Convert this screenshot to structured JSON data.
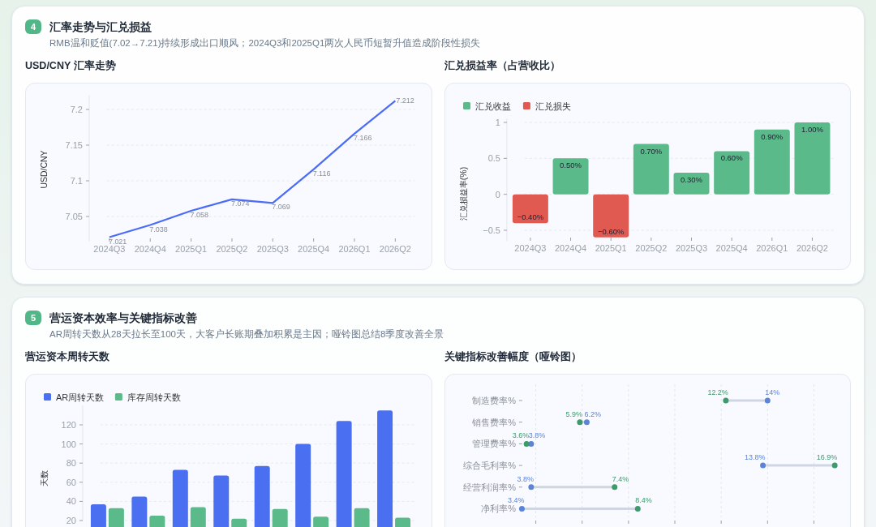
{
  "sections": [
    {
      "number": "4",
      "title": "汇率走势与汇兑损益",
      "subtitle": "RMB温和贬值(7.02→7.21)持续形成出口顺风；2024Q3和2025Q1两次人民币短暂升值造成阶段性损失",
      "panels": [
        {
          "title": "USD/CNY 汇率走势",
          "chart_data": {
            "type": "line",
            "ylabel": "USD/CNY",
            "categories": [
              "2024Q3",
              "2024Q4",
              "2025Q1",
              "2025Q2",
              "2025Q3",
              "2025Q4",
              "2026Q1",
              "2026Q2"
            ],
            "series": [
              {
                "color": "#4a6cf7",
                "values": [
                  7.021,
                  7.038,
                  7.058,
                  7.074,
                  7.069,
                  7.116,
                  7.166,
                  7.212
                ]
              }
            ],
            "ylim": [
              7.015,
              7.22
            ],
            "yticks": [
              7.05,
              7.1,
              7.15,
              7.2
            ],
            "grid": true,
            "data_labels": true
          }
        },
        {
          "title": "汇兑损益率（占营收比）",
          "chart_data": {
            "type": "bar",
            "ylabel": "汇兑损益率(%)",
            "categories": [
              "2024Q3",
              "2024Q4",
              "2025Q1",
              "2025Q2",
              "2025Q3",
              "2025Q4",
              "2026Q1",
              "2026Q2"
            ],
            "series": [
              {
                "name": "汇兑收益",
                "color": "#5bba8a",
                "values": [
                  null,
                  0.5,
                  null,
                  0.7,
                  0.3,
                  0.6,
                  0.9,
                  1.0
                ],
                "value_labels": [
                  null,
                  "0.50%",
                  null,
                  "0.70%",
                  "0.30%",
                  "0.60%",
                  "0.90%",
                  "1.00%"
                ]
              },
              {
                "name": "汇兑损失",
                "color": "#e05a52",
                "values": [
                  -0.4,
                  null,
                  -0.6,
                  null,
                  null,
                  null,
                  null,
                  null
                ],
                "value_labels": [
                  "−0.40%",
                  null,
                  "−0.60%",
                  null,
                  null,
                  null,
                  null,
                  null
                ]
              }
            ],
            "ylim": [
              -0.65,
              1.05
            ],
            "yticks": [
              {
                "value": -0.5,
                "label": "−0.5"
              },
              0,
              0.5,
              1
            ],
            "grid": true,
            "legend": "top-left",
            "stacked": true
          }
        }
      ]
    },
    {
      "number": "5",
      "title": "营运资本效率与关键指标改善",
      "subtitle": "AR周转天数从28天拉长至100天，大客户长账期叠加积累是主因；哑铃图总结8季度改善全景",
      "panels": [
        {
          "title": "营运资本周转天数",
          "chart_data": {
            "type": "bar",
            "ylabel": "天数",
            "series": [
              {
                "name": "AR周转天数",
                "color": "#4a6ff0",
                "values": [
                  37,
                  45,
                  73,
                  67,
                  77,
                  100,
                  124,
                  135
                ]
              },
              {
                "name": "库存周转天数",
                "color": "#5bba8a",
                "values": [
                  33,
                  25,
                  34,
                  22,
                  32,
                  24,
                  33,
                  23
                ]
              }
            ],
            "ylim": [
              20,
              140
            ],
            "yticks": [
              20,
              40,
              60,
              80,
              100,
              120
            ],
            "grid": true,
            "legend": "top-left",
            "stacked": false
          }
        },
        {
          "title": "关键指标改善幅度（哑铃图）",
          "chart_data": {
            "type": "scatter",
            "orientation": "horizontal",
            "categories": [
              "制造费率%",
              "销售费率%",
              "管理费率%",
              "综合毛利率%",
              "经营利润率%",
              "净利率%"
            ],
            "series": [
              {
                "color": "#5b84d6",
                "values": [
                  14,
                  6.2,
                  3.8,
                  13.8,
                  3.8,
                  3.4
                ],
                "value_labels": [
                  "14%",
                  "6.2%",
                  "3.8%",
                  "13.8%",
                  "3.8%",
                  "3.4%"
                ]
              },
              {
                "color": "#3d9a6b",
                "values": [
                  12.2,
                  5.9,
                  3.6,
                  16.9,
                  7.4,
                  8.4
                ],
                "value_labels": [
                  "12.2%",
                  "5.9%",
                  "3.6%",
                  "16.9%",
                  "7.4%",
                  "8.4%"
                ]
              }
            ],
            "grid": true
          }
        }
      ]
    }
  ]
}
